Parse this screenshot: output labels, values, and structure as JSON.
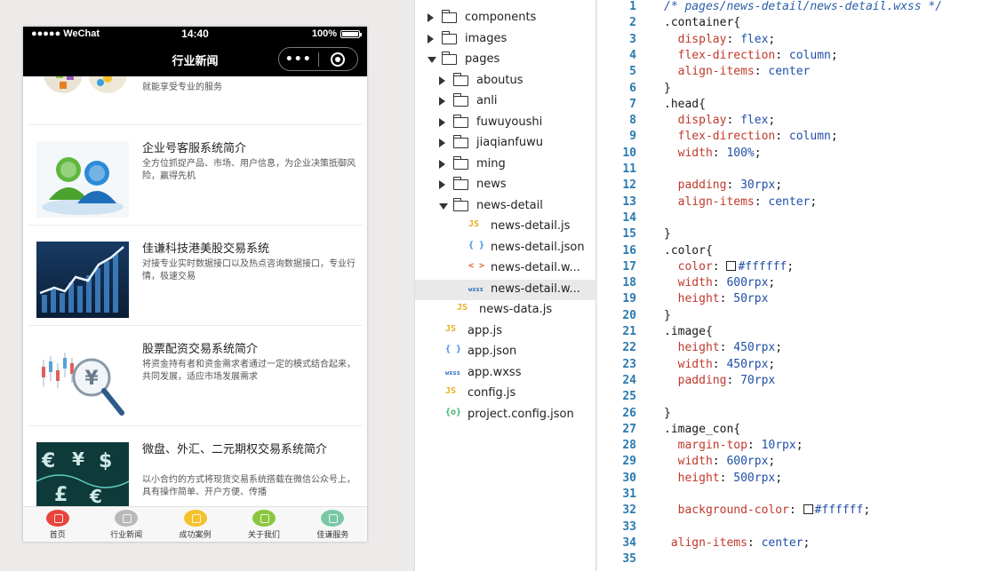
{
  "simulator": {
    "status_bar": {
      "carrier": "●●●●● WeChat",
      "time": "14:40",
      "battery": "100%"
    },
    "nav_title": "行业新闻",
    "capsule_dots": "•••",
    "news": [
      {
        "title": "",
        "desc": "就能享受专业的服务"
      },
      {
        "title": "企业号客服系统简介",
        "desc": "全方位抓捉产品、市场、用户信息，为企业决策抵御风险，赢得先机"
      },
      {
        "title": "佳谦科技港美股交易系统",
        "desc": "对接专业实时数据接口以及热点咨询数据接口，专业行情，极速交易"
      },
      {
        "title": "股票配资交易系统简介",
        "desc": "将资金持有者和资金需求者通过一定的模式结合起来，共同发展，适应市场发展需求"
      },
      {
        "title": "微盘、外汇、二元期权交易系统简介",
        "desc": "以小合约的方式将现货交易系统搭载在微信公众号上，具有操作简单、开户方便、传播"
      }
    ],
    "tabs": [
      {
        "label": "首页",
        "color": "#e8453c"
      },
      {
        "label": "行业新闻",
        "color": "#b9b9b9"
      },
      {
        "label": "成功案例",
        "color": "#f4c12a"
      },
      {
        "label": "关于我们",
        "color": "#8cc63e"
      },
      {
        "label": "佳谦服务",
        "color": "#7ac7a6"
      }
    ]
  },
  "file_tree": [
    {
      "label": "components",
      "type": "folder",
      "state": "collapsed",
      "depth": 0
    },
    {
      "label": "images",
      "type": "folder",
      "state": "collapsed",
      "depth": 0
    },
    {
      "label": "pages",
      "type": "folder",
      "state": "expanded",
      "depth": 0
    },
    {
      "label": "aboutus",
      "type": "folder",
      "state": "collapsed",
      "depth": 1
    },
    {
      "label": "anli",
      "type": "folder",
      "state": "collapsed",
      "depth": 1
    },
    {
      "label": "fuwuyoushi",
      "type": "folder",
      "state": "collapsed",
      "depth": 1
    },
    {
      "label": "jiaqianfuwu",
      "type": "folder",
      "state": "collapsed",
      "depth": 1
    },
    {
      "label": "ming",
      "type": "folder",
      "state": "collapsed",
      "depth": 1
    },
    {
      "label": "news",
      "type": "folder",
      "state": "collapsed",
      "depth": 1
    },
    {
      "label": "news-detail",
      "type": "folder",
      "state": "expanded",
      "depth": 1
    },
    {
      "label": "news-detail.js",
      "type": "js",
      "depth": 2
    },
    {
      "label": "news-detail.json",
      "type": "json",
      "depth": 2
    },
    {
      "label": "news-detail.w...",
      "type": "wxml",
      "depth": 2
    },
    {
      "label": "news-detail.w...",
      "type": "wxss",
      "depth": 2,
      "selected": true
    },
    {
      "label": "news-data.js",
      "type": "js",
      "depth": 1
    },
    {
      "label": "app.js",
      "type": "js",
      "depth": 0
    },
    {
      "label": "app.json",
      "type": "json",
      "depth": 0
    },
    {
      "label": "app.wxss",
      "type": "wxss",
      "depth": 0
    },
    {
      "label": "config.js",
      "type": "js",
      "depth": 0
    },
    {
      "label": "project.config.json",
      "type": "config",
      "depth": 0
    }
  ],
  "file_icons": {
    "js": {
      "glyph": "JS",
      "color": "#e6b120"
    },
    "json": {
      "glyph": "{ }",
      "color": "#3a8ee6"
    },
    "wxml": {
      "glyph": "< >",
      "color": "#e2622b"
    },
    "wxss": {
      "glyph": "wxss",
      "color": "#2d6cc0"
    },
    "config": {
      "glyph": "{o}",
      "color": "#3bb36a"
    }
  },
  "editor": {
    "lines": [
      [
        {
          "t": "/* pages/news-detail/news-detail.wxss */",
          "c": "comment"
        }
      ],
      [
        {
          "t": ".container{",
          "c": "sel"
        }
      ],
      [
        {
          "t": "  display",
          "c": "prop"
        },
        {
          "t": ": ",
          "c": "punc"
        },
        {
          "t": "flex",
          "c": "val"
        },
        {
          "t": ";",
          "c": "punc"
        }
      ],
      [
        {
          "t": "  flex-direction",
          "c": "prop"
        },
        {
          "t": ": ",
          "c": "punc"
        },
        {
          "t": "column",
          "c": "val"
        },
        {
          "t": ";",
          "c": "punc"
        }
      ],
      [
        {
          "t": "  align-items",
          "c": "prop"
        },
        {
          "t": ": ",
          "c": "punc"
        },
        {
          "t": "center",
          "c": "val"
        }
      ],
      [
        {
          "t": "}",
          "c": "sel"
        }
      ],
      [
        {
          "t": ".head{",
          "c": "sel"
        }
      ],
      [
        {
          "t": "  display",
          "c": "prop"
        },
        {
          "t": ": ",
          "c": "punc"
        },
        {
          "t": "flex",
          "c": "val"
        },
        {
          "t": ";",
          "c": "punc"
        }
      ],
      [
        {
          "t": "  flex-direction",
          "c": "prop"
        },
        {
          "t": ": ",
          "c": "punc"
        },
        {
          "t": "column",
          "c": "val"
        },
        {
          "t": ";",
          "c": "punc"
        }
      ],
      [
        {
          "t": "  width",
          "c": "prop"
        },
        {
          "t": ": ",
          "c": "punc"
        },
        {
          "t": "100%",
          "c": "val"
        },
        {
          "t": ";",
          "c": "punc"
        }
      ],
      [],
      [
        {
          "t": "  padding",
          "c": "prop"
        },
        {
          "t": ": ",
          "c": "punc"
        },
        {
          "t": "30rpx",
          "c": "val"
        },
        {
          "t": ";",
          "c": "punc"
        }
      ],
      [
        {
          "t": "  align-items",
          "c": "prop"
        },
        {
          "t": ": ",
          "c": "punc"
        },
        {
          "t": "center",
          "c": "val"
        },
        {
          "t": ";",
          "c": "punc"
        }
      ],
      [],
      [
        {
          "t": "}",
          "c": "sel"
        }
      ],
      [
        {
          "t": ".color{",
          "c": "sel"
        }
      ],
      [
        {
          "t": "  color",
          "c": "prop"
        },
        {
          "t": ": ",
          "c": "punc"
        },
        {
          "t": "#ffffff",
          "c": "val",
          "swatch": true
        },
        {
          "t": ";",
          "c": "punc"
        }
      ],
      [
        {
          "t": "  width",
          "c": "prop"
        },
        {
          "t": ": ",
          "c": "punc"
        },
        {
          "t": "600rpx",
          "c": "val"
        },
        {
          "t": ";",
          "c": "punc"
        }
      ],
      [
        {
          "t": "  height",
          "c": "prop"
        },
        {
          "t": ": ",
          "c": "punc"
        },
        {
          "t": "50rpx",
          "c": "val"
        }
      ],
      [
        {
          "t": "}",
          "c": "sel"
        }
      ],
      [
        {
          "t": ".image{",
          "c": "sel"
        }
      ],
      [
        {
          "t": "  height",
          "c": "prop"
        },
        {
          "t": ": ",
          "c": "punc"
        },
        {
          "t": "450rpx",
          "c": "val"
        },
        {
          "t": ";",
          "c": "punc"
        }
      ],
      [
        {
          "t": "  width",
          "c": "prop"
        },
        {
          "t": ": ",
          "c": "punc"
        },
        {
          "t": "450rpx",
          "c": "val"
        },
        {
          "t": ";",
          "c": "punc"
        }
      ],
      [
        {
          "t": "  padding",
          "c": "prop"
        },
        {
          "t": ": ",
          "c": "punc"
        },
        {
          "t": "70rpx",
          "c": "val"
        }
      ],
      [],
      [
        {
          "t": "}",
          "c": "sel"
        }
      ],
      [
        {
          "t": ".image_con{",
          "c": "sel"
        }
      ],
      [
        {
          "t": "  margin-top",
          "c": "prop"
        },
        {
          "t": ": ",
          "c": "punc"
        },
        {
          "t": "10rpx",
          "c": "val"
        },
        {
          "t": ";",
          "c": "punc"
        }
      ],
      [
        {
          "t": "  width",
          "c": "prop"
        },
        {
          "t": ": ",
          "c": "punc"
        },
        {
          "t": "600rpx",
          "c": "val"
        },
        {
          "t": ";",
          "c": "punc"
        }
      ],
      [
        {
          "t": "  height",
          "c": "prop"
        },
        {
          "t": ": ",
          "c": "punc"
        },
        {
          "t": "500rpx",
          "c": "val"
        },
        {
          "t": ";",
          "c": "punc"
        }
      ],
      [],
      [
        {
          "t": "  background-color",
          "c": "prop"
        },
        {
          "t": ": ",
          "c": "punc"
        },
        {
          "t": "#ffffff",
          "c": "val",
          "swatch": true
        },
        {
          "t": ";",
          "c": "punc"
        }
      ],
      [],
      [
        {
          "t": " align-items",
          "c": "prop"
        },
        {
          "t": ": ",
          "c": "punc"
        },
        {
          "t": "center",
          "c": "val"
        },
        {
          "t": ";",
          "c": "punc"
        }
      ],
      []
    ]
  }
}
